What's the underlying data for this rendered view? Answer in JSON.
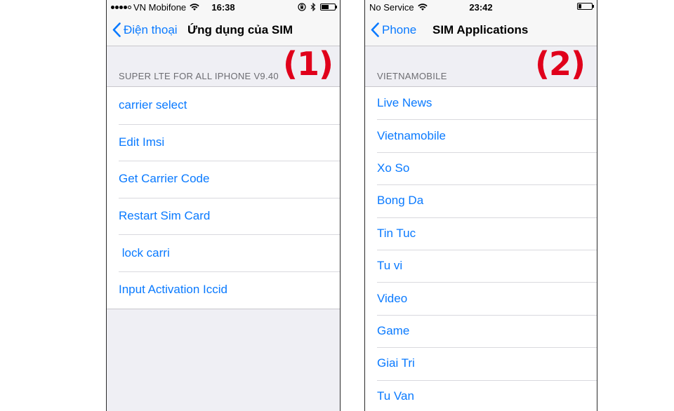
{
  "screen1": {
    "status": {
      "carrier": "VN Mobifone",
      "time": "16:38",
      "signal_bars": 4,
      "battery_level": 0.5
    },
    "nav": {
      "back_label": "Điện thoại",
      "title": "Ứng dụng của SIM"
    },
    "section_header": "SUPER LTE FOR ALL IPHONE V9.40",
    "items": [
      "carrier select",
      "Edit Imsi",
      "Get Carrier Code",
      "Restart Sim Card",
      " lock carri",
      "Input Activation Iccid"
    ],
    "marker": "(1)"
  },
  "screen2": {
    "status": {
      "carrier": "No Service",
      "time": "23:42",
      "battery_level": 0.2
    },
    "nav": {
      "back_label": "Phone",
      "title": "SIM Applications"
    },
    "section_header": "VIETNAMOBILE",
    "items": [
      "Live News",
      "Vietnamobile",
      "Xo So",
      "Bong Da",
      "Tin Tuc",
      "Tu vi",
      "Video",
      "Game",
      "Giai Tri",
      "Tu Van"
    ],
    "marker": "(2)"
  },
  "colors": {
    "accent": "#0a7aff",
    "marker": "#e0001b",
    "background": "#efeff4"
  }
}
